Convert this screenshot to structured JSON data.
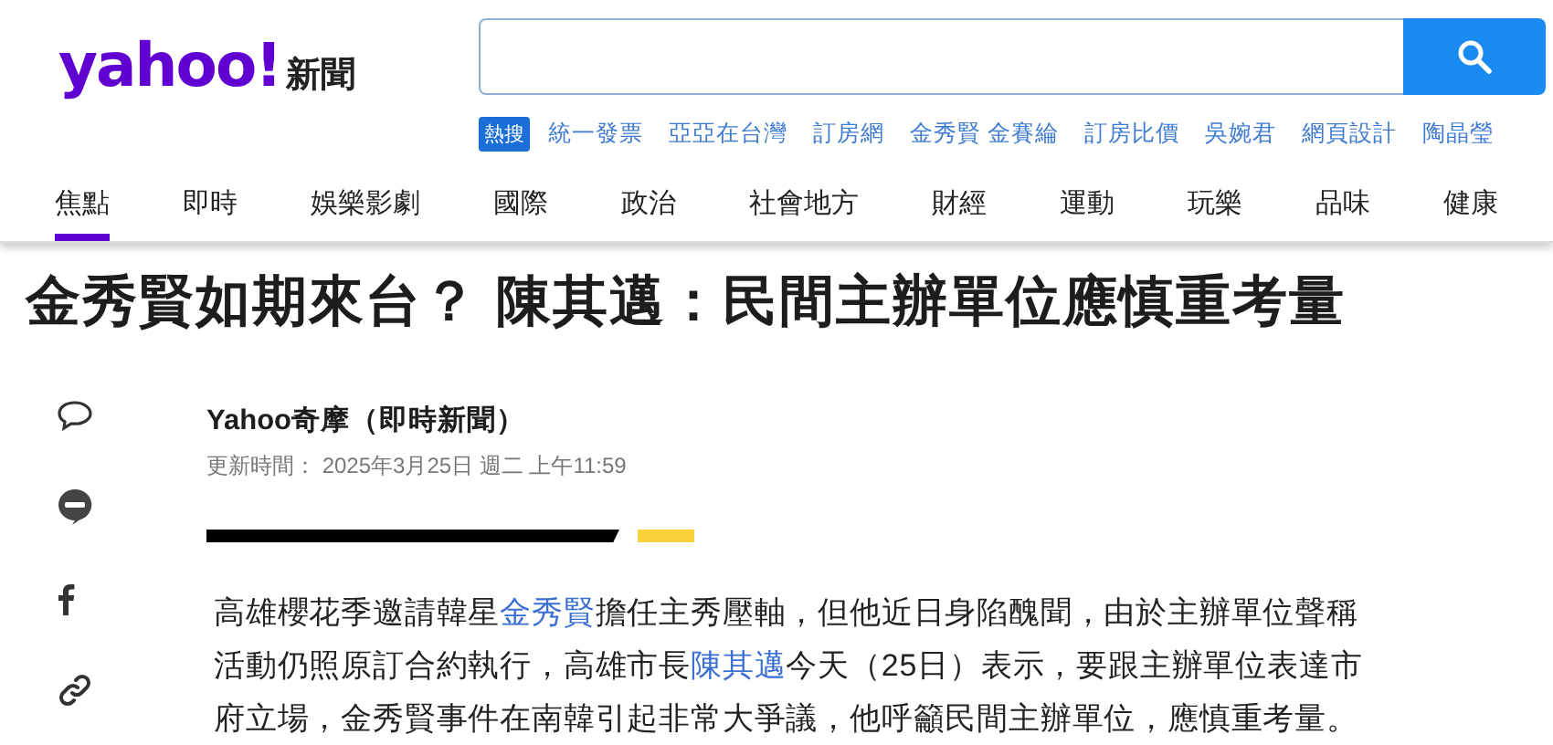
{
  "logo": {
    "brand": "yahoo!",
    "section": "新聞"
  },
  "trending": {
    "badge": "熱搜",
    "items": [
      "統一發票",
      "亞亞在台灣",
      "訂房網",
      "金秀賢 金賽綸",
      "訂房比價",
      "吳婉君",
      "網頁設計",
      "陶晶瑩"
    ]
  },
  "nav": [
    {
      "label": "焦點",
      "selected": true
    },
    {
      "label": "即時",
      "selected": false
    },
    {
      "label": "娛樂影劇",
      "selected": false
    },
    {
      "label": "國際",
      "selected": false
    },
    {
      "label": "政治",
      "selected": false
    },
    {
      "label": "社會地方",
      "selected": false
    },
    {
      "label": "財經",
      "selected": false
    },
    {
      "label": "運動",
      "selected": false
    },
    {
      "label": "玩樂",
      "selected": false
    },
    {
      "label": "品味",
      "selected": false
    },
    {
      "label": "健康",
      "selected": false
    }
  ],
  "article": {
    "title": "金秀賢如期來台？ 陳其邁：民間主辦單位應慎重考量",
    "author": "Yahoo奇摩（即時新聞）",
    "updated": "更新時間： 2025年3月25日 週二 上午11:59",
    "paragraph": [
      {
        "text": "高雄櫻花季邀請韓星",
        "link": false
      },
      {
        "text": "金秀賢",
        "link": true
      },
      {
        "text": "擔任主秀壓軸，但他近日身陷醜聞，由於主辦單位聲稱活動仍照原訂合約執行，高雄市長",
        "link": false
      },
      {
        "text": "陳其邁",
        "link": true
      },
      {
        "text": "今天（25日）表示，要跟主辦單位表達市府立場，金秀賢事件在南韓引起非常大爭議，他呼籲民間主辦單位，應慎重考量。",
        "link": false
      }
    ]
  }
}
